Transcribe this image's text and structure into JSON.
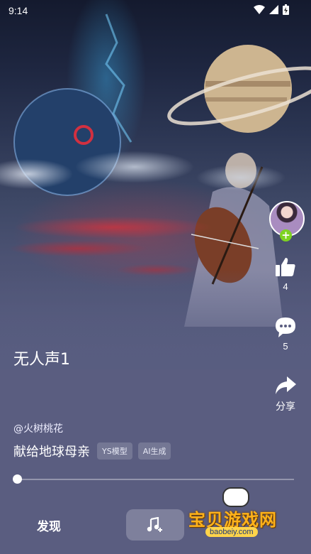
{
  "status_bar": {
    "time": "9:14"
  },
  "song": {
    "title": "无人声1",
    "author": "@火树桃花",
    "description": "献给地球母亲",
    "tags": [
      "YS模型",
      "AI生成"
    ],
    "progress": 0.0
  },
  "actions": {
    "likes": "4",
    "comments": "5",
    "share_label": "分享"
  },
  "nav": {
    "discover_label": "发现"
  },
  "watermark": {
    "brand": "宝贝游戏网",
    "url": "baobeiy.com"
  }
}
